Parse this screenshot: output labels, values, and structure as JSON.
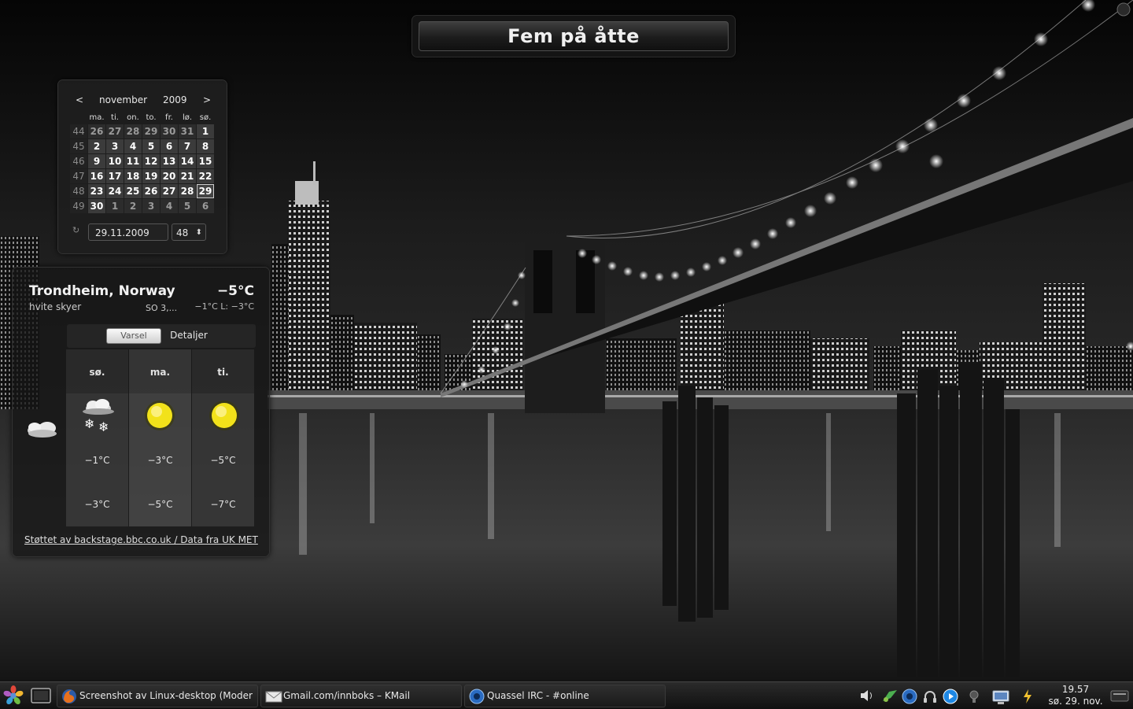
{
  "clock_widget": {
    "text": "Fem på åtte"
  },
  "calendar": {
    "prev_label": "<",
    "month": "november",
    "year": "2009",
    "next_label": ">",
    "weekday_headers": [
      "ma.",
      "ti.",
      "on.",
      "to.",
      "fr.",
      "lø.",
      "sø."
    ],
    "weeks": [
      {
        "num": "44",
        "days": [
          {
            "d": "26",
            "m": "oth"
          },
          {
            "d": "27",
            "m": "oth"
          },
          {
            "d": "28",
            "m": "oth"
          },
          {
            "d": "29",
            "m": "oth"
          },
          {
            "d": "30",
            "m": "oth"
          },
          {
            "d": "31",
            "m": "oth"
          },
          {
            "d": "1",
            "m": "cur"
          }
        ]
      },
      {
        "num": "45",
        "days": [
          {
            "d": "2",
            "m": "cur"
          },
          {
            "d": "3",
            "m": "cur"
          },
          {
            "d": "4",
            "m": "cur"
          },
          {
            "d": "5",
            "m": "cur"
          },
          {
            "d": "6",
            "m": "cur"
          },
          {
            "d": "7",
            "m": "cur"
          },
          {
            "d": "8",
            "m": "cur"
          }
        ]
      },
      {
        "num": "46",
        "days": [
          {
            "d": "9",
            "m": "cur"
          },
          {
            "d": "10",
            "m": "cur"
          },
          {
            "d": "11",
            "m": "cur"
          },
          {
            "d": "12",
            "m": "cur"
          },
          {
            "d": "13",
            "m": "cur"
          },
          {
            "d": "14",
            "m": "cur"
          },
          {
            "d": "15",
            "m": "cur"
          }
        ]
      },
      {
        "num": "47",
        "days": [
          {
            "d": "16",
            "m": "cur"
          },
          {
            "d": "17",
            "m": "cur"
          },
          {
            "d": "18",
            "m": "cur"
          },
          {
            "d": "19",
            "m": "cur"
          },
          {
            "d": "20",
            "m": "cur"
          },
          {
            "d": "21",
            "m": "cur"
          },
          {
            "d": "22",
            "m": "cur"
          }
        ]
      },
      {
        "num": "48",
        "days": [
          {
            "d": "23",
            "m": "cur"
          },
          {
            "d": "24",
            "m": "cur"
          },
          {
            "d": "25",
            "m": "cur"
          },
          {
            "d": "26",
            "m": "cur"
          },
          {
            "d": "27",
            "m": "cur"
          },
          {
            "d": "28",
            "m": "cur"
          },
          {
            "d": "29",
            "m": "today"
          }
        ]
      },
      {
        "num": "49",
        "days": [
          {
            "d": "30",
            "m": "cur"
          },
          {
            "d": "1",
            "m": "oth"
          },
          {
            "d": "2",
            "m": "oth"
          },
          {
            "d": "3",
            "m": "oth"
          },
          {
            "d": "4",
            "m": "oth"
          },
          {
            "d": "5",
            "m": "oth"
          },
          {
            "d": "6",
            "m": "oth"
          }
        ]
      }
    ],
    "date_field_value": "29.11.2009",
    "week_field_value": "48"
  },
  "weather": {
    "location": "Trondheim, Norway",
    "temperature": "−5°C",
    "condition": "hvite skyer",
    "wind": "SO 3,...",
    "hi_lo": "−1°C L: −3°C",
    "tabs": {
      "forecast": "Varsel",
      "details": "Detaljer"
    },
    "current_icon": "partly-cloudy-night-icon",
    "days": [
      {
        "name": "sø.",
        "icon": "snow-cloud-icon",
        "high": "−1°C",
        "low": "−3°C"
      },
      {
        "name": "ma.",
        "icon": "sun-icon",
        "high": "−3°C",
        "low": "−5°C"
      },
      {
        "name": "ti.",
        "icon": "sun-icon",
        "high": "−5°C",
        "low": "−7°C"
      }
    ],
    "credit": "Støttet av backstage.bbc.co.uk / Data fra UK MET"
  },
  "taskbar": {
    "tasks": [
      {
        "label": "Screenshot av Linux-desktop (Moder",
        "icon": "firefox-icon"
      },
      {
        "label": "Gmail.com/innboks – KMail",
        "icon": "kmail-icon"
      },
      {
        "label": "Quassel IRC - #online",
        "icon": "quassel-icon"
      }
    ],
    "tray_icons": [
      "volume-icon",
      "network-icon",
      "quassel-tray-icon",
      "headphones-icon",
      "media-player-icon",
      "bulb-icon",
      "display-icon",
      "power-icon"
    ],
    "clock_time": "19.57",
    "clock_date": "sø. 29. nov."
  },
  "colors": {
    "accent_sun": "#f2e21a",
    "panel_bg": "#1e1e1e"
  }
}
